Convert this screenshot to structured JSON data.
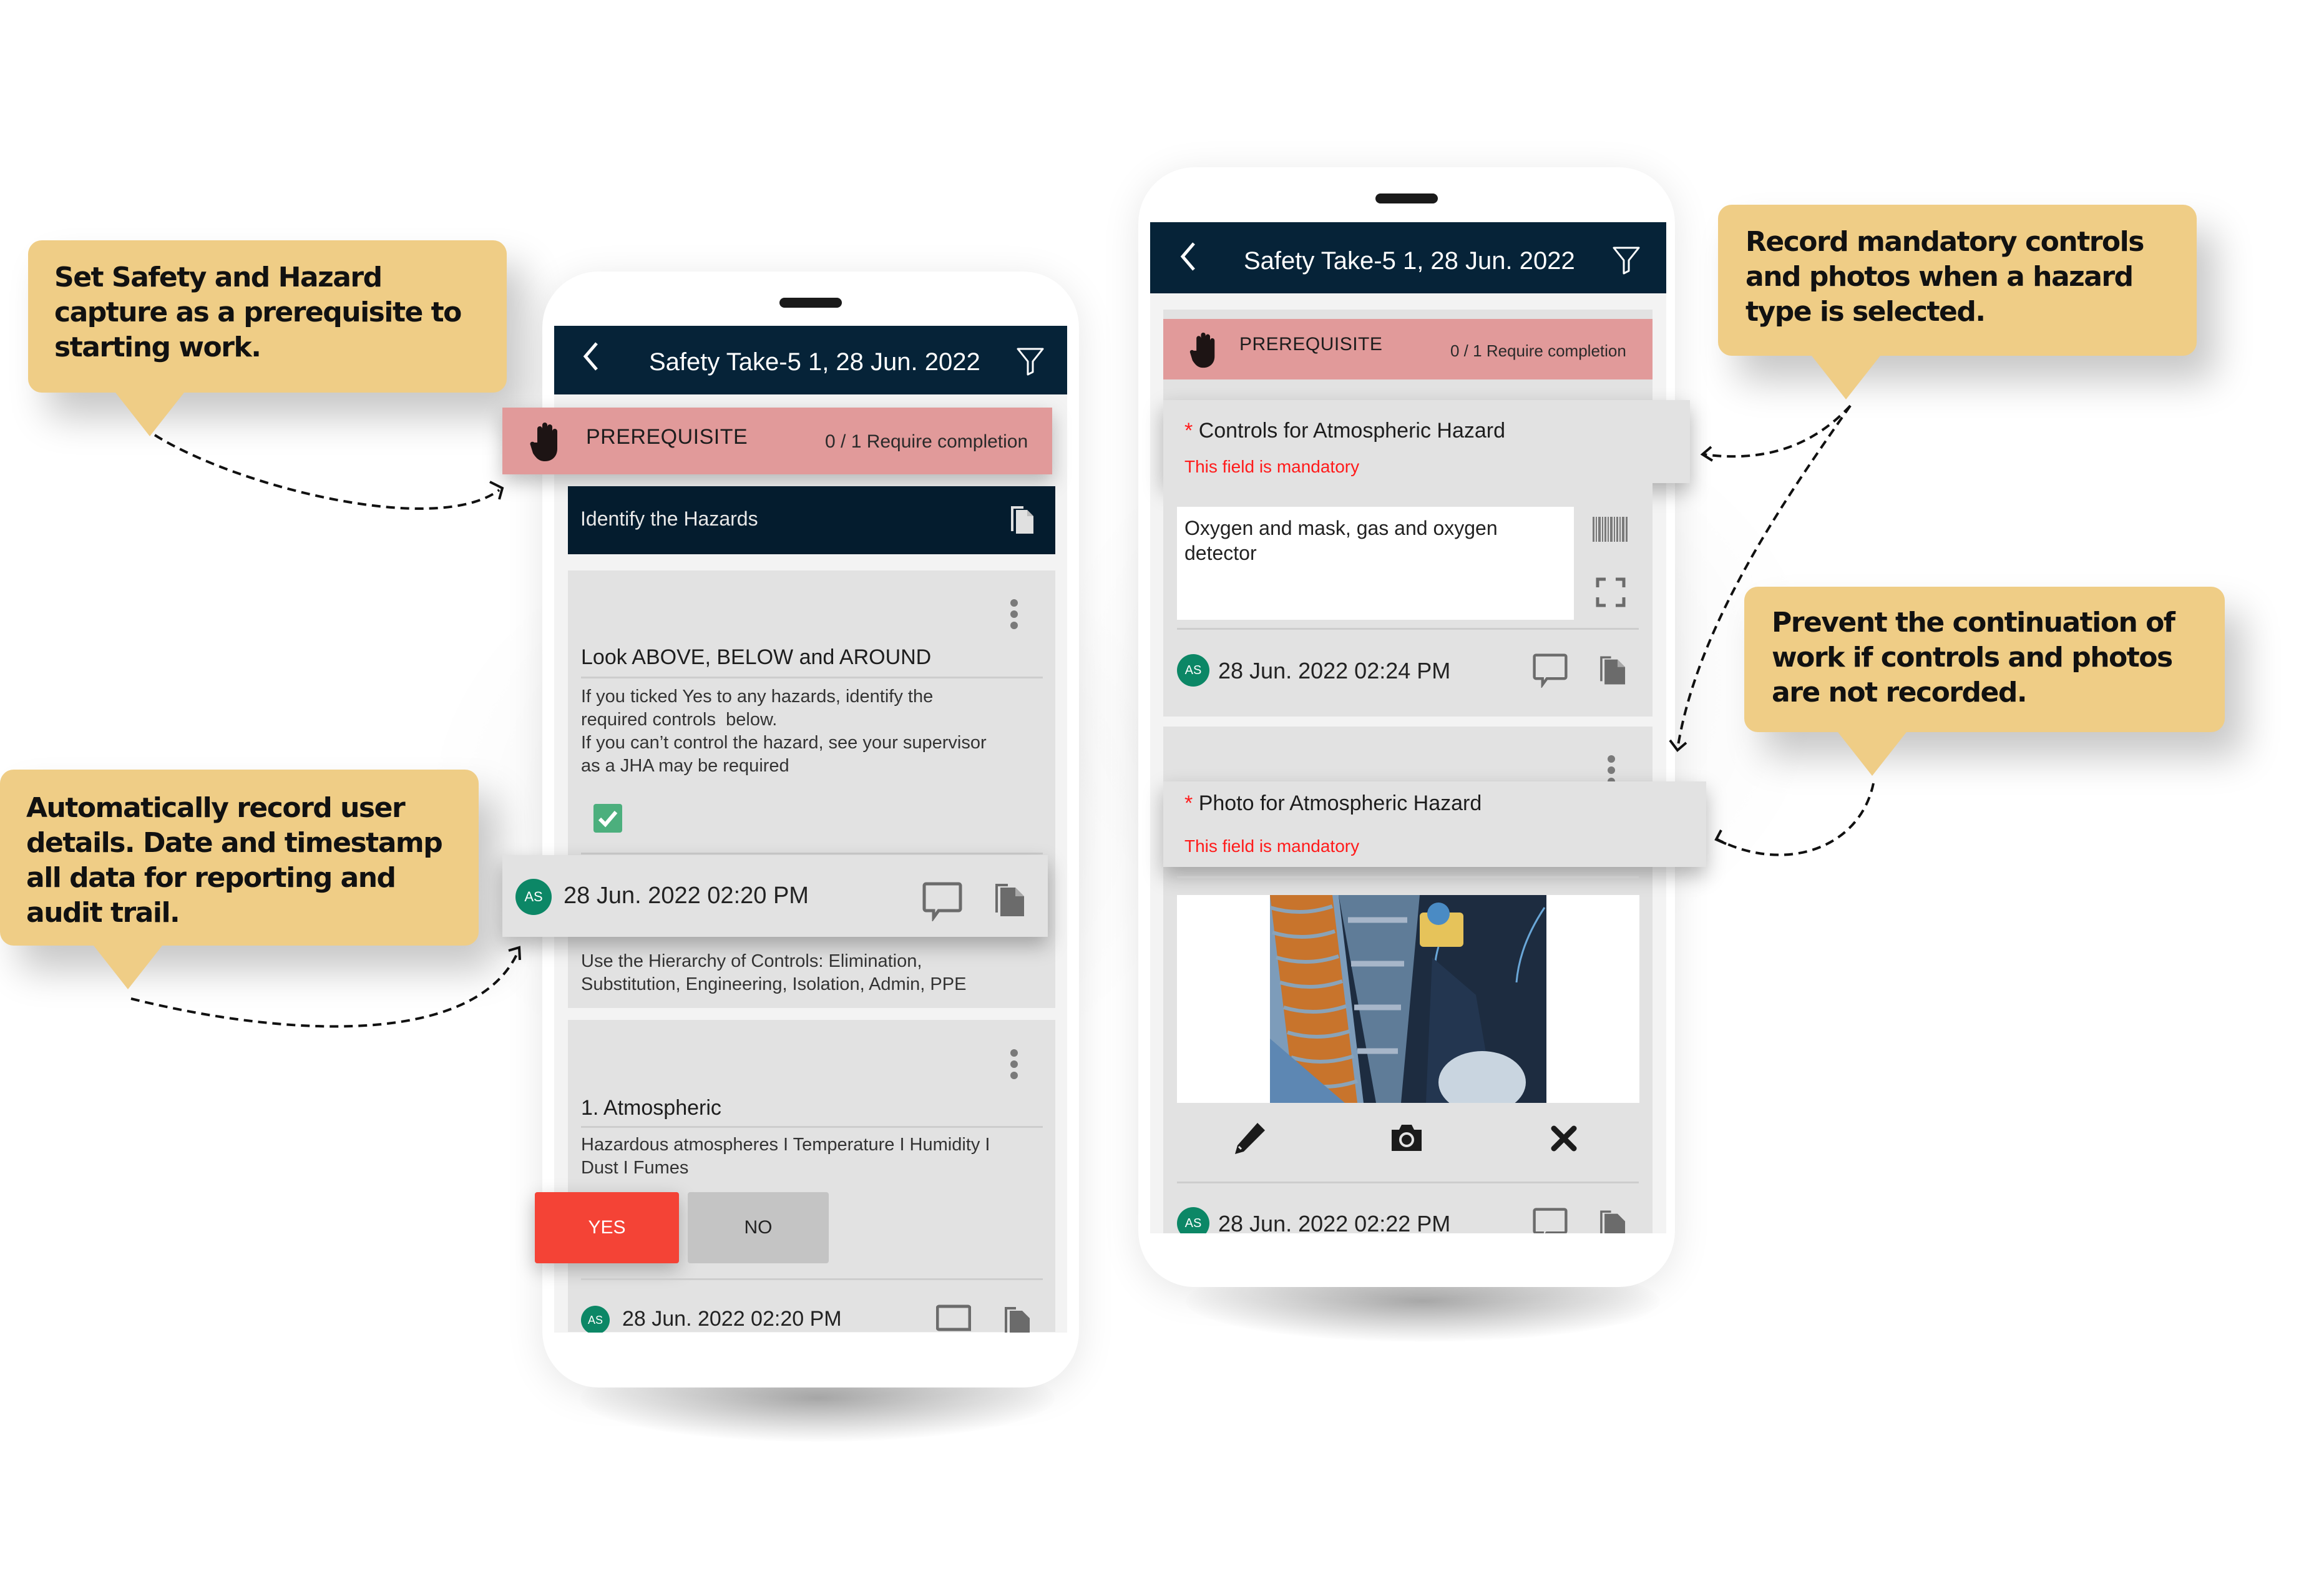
{
  "callouts": [
    {
      "id": "prerequisite",
      "text": "Set Safety and Hazard capture as a prerequisite to starting work."
    },
    {
      "id": "audit",
      "text": "Automatically record user details. Date and timestamp all data for reporting and audit trail."
    },
    {
      "id": "mandatory",
      "text": "Record mandatory controls and photos when a hazard type is selected."
    },
    {
      "id": "prevent",
      "text": "Prevent the continuation of work if controls and photos are not recorded."
    }
  ],
  "colors": {
    "header_bg": "#062338",
    "prerequisite_bg": "#e19a9a",
    "callout_bg": "#efcd86",
    "avatar_bg": "#0c8766",
    "yes_bg": "#f44336",
    "mandatory_text": "#ff1b1b",
    "checkbox": "#4caf7d"
  },
  "left_phone": {
    "header": {
      "title": "Safety Take-5 1, 28 Jun. 2022",
      "back_icon": "chevron-left-icon",
      "filter_icon": "filter-icon"
    },
    "prerequisite": {
      "label": "PREREQUISITE",
      "count": "0 / 1 Require completion",
      "icon": "hand-stop-icon"
    },
    "section": {
      "title": "Identify the Hazards",
      "icon": "copy-icon"
    },
    "card1": {
      "title": "Look ABOVE, BELOW and AROUND",
      "desc_lines": [
        "If you ticked Yes to any hazards, identify the",
        "required controls  below.",
        "If you can’t control the hazard, see your supervisor",
        "as a JHA may be required"
      ],
      "checked": true,
      "user_initials": "AS",
      "timestamp": "28 Jun. 2022 02:20 PM",
      "hint_lines": [
        "Use the Hierarchy of Controls: Elimination,",
        "Substitution, Engineering, Isolation, Admin, PPE"
      ]
    },
    "card2": {
      "title": "1. Atmospheric",
      "desc_lines": [
        "Hazardous atmospheres I Temperature I Humidity I",
        "Dust I Fumes"
      ],
      "yes_label": "YES",
      "no_label": "NO",
      "selected": "YES",
      "user_initials": "AS",
      "timestamp": "28 Jun. 2022 02:20 PM"
    }
  },
  "right_phone": {
    "header": {
      "title": "Safety Take-5 1, 28 Jun. 2022",
      "back_icon": "chevron-left-icon",
      "filter_icon": "filter-icon"
    },
    "prerequisite": {
      "label": "PREREQUISITE",
      "count": "0 / 1 Require completion",
      "icon": "hand-stop-icon"
    },
    "controls": {
      "required_marker": "*",
      "title": "Controls for Atmospheric Hazard",
      "error": "This field is mandatory",
      "value_lines": [
        "Oxygen and mask, gas and oxygen",
        "detector"
      ],
      "user_initials": "AS",
      "timestamp": "28 Jun. 2022 02:24 PM"
    },
    "photo": {
      "required_marker": "*",
      "title": "Photo for Atmospheric Hazard",
      "error": "This field is mandatory",
      "image_alt": "confined space with orange ducting, ladder and gas detector",
      "actions": [
        "edit-icon",
        "camera-icon",
        "close-icon"
      ],
      "user_initials": "AS",
      "timestamp": "28 Jun. 2022 02:22 PM"
    }
  }
}
